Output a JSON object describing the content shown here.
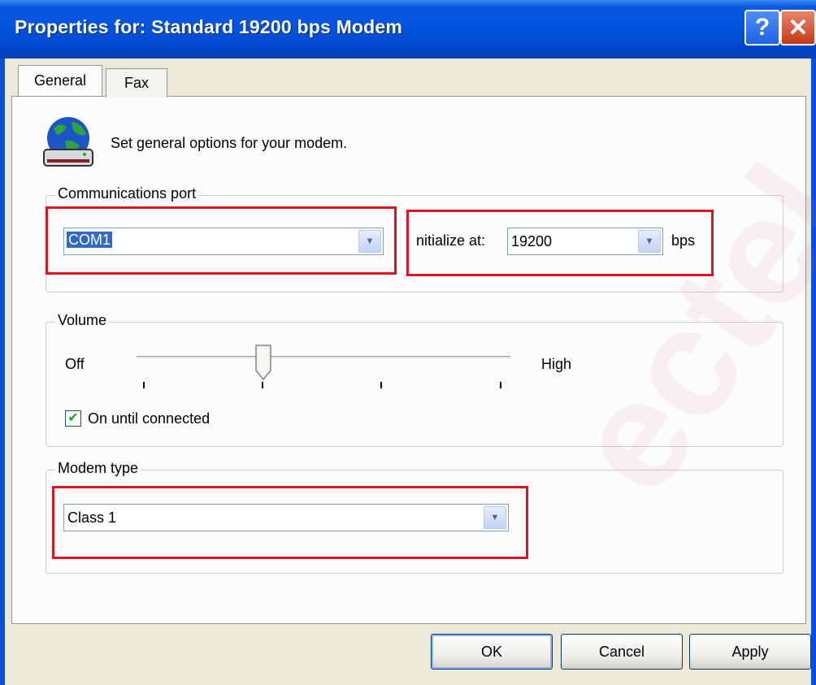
{
  "window": {
    "title": "Properties for: Standard 19200 bps Modem",
    "help_glyph": "?",
    "close_glyph": "✕"
  },
  "tabs": [
    {
      "label": "General",
      "active": true
    },
    {
      "label": "Fax",
      "active": false
    }
  ],
  "general": {
    "intro_text": "Set general options for your modem.",
    "comm_port": {
      "group_label": "Communications port",
      "port_value": "COM1",
      "initialize_label": "nitialize at:",
      "speed_value": "19200",
      "speed_unit": "bps"
    },
    "volume": {
      "group_label": "Volume",
      "min_label": "Off",
      "max_label": "High",
      "level_fraction": 0.333,
      "on_until_connected_label": "On until connected",
      "on_until_connected_checked": true
    },
    "modem_type": {
      "group_label": "Modem type",
      "value": "Class 1"
    }
  },
  "buttons": {
    "ok": "OK",
    "cancel": "Cancel",
    "apply": "Apply"
  },
  "icons": {
    "modem": "modem-globe-icon",
    "dropdown": "chevron-down-icon",
    "help": "help-icon",
    "close": "close-icon",
    "check": "checkmark-icon"
  },
  "colors": {
    "titlebar": "#0052de",
    "selection": "#316ac5",
    "highlight_box": "#e0141e",
    "dialog_bg": "#ece9d8"
  },
  "watermark": "ectel"
}
